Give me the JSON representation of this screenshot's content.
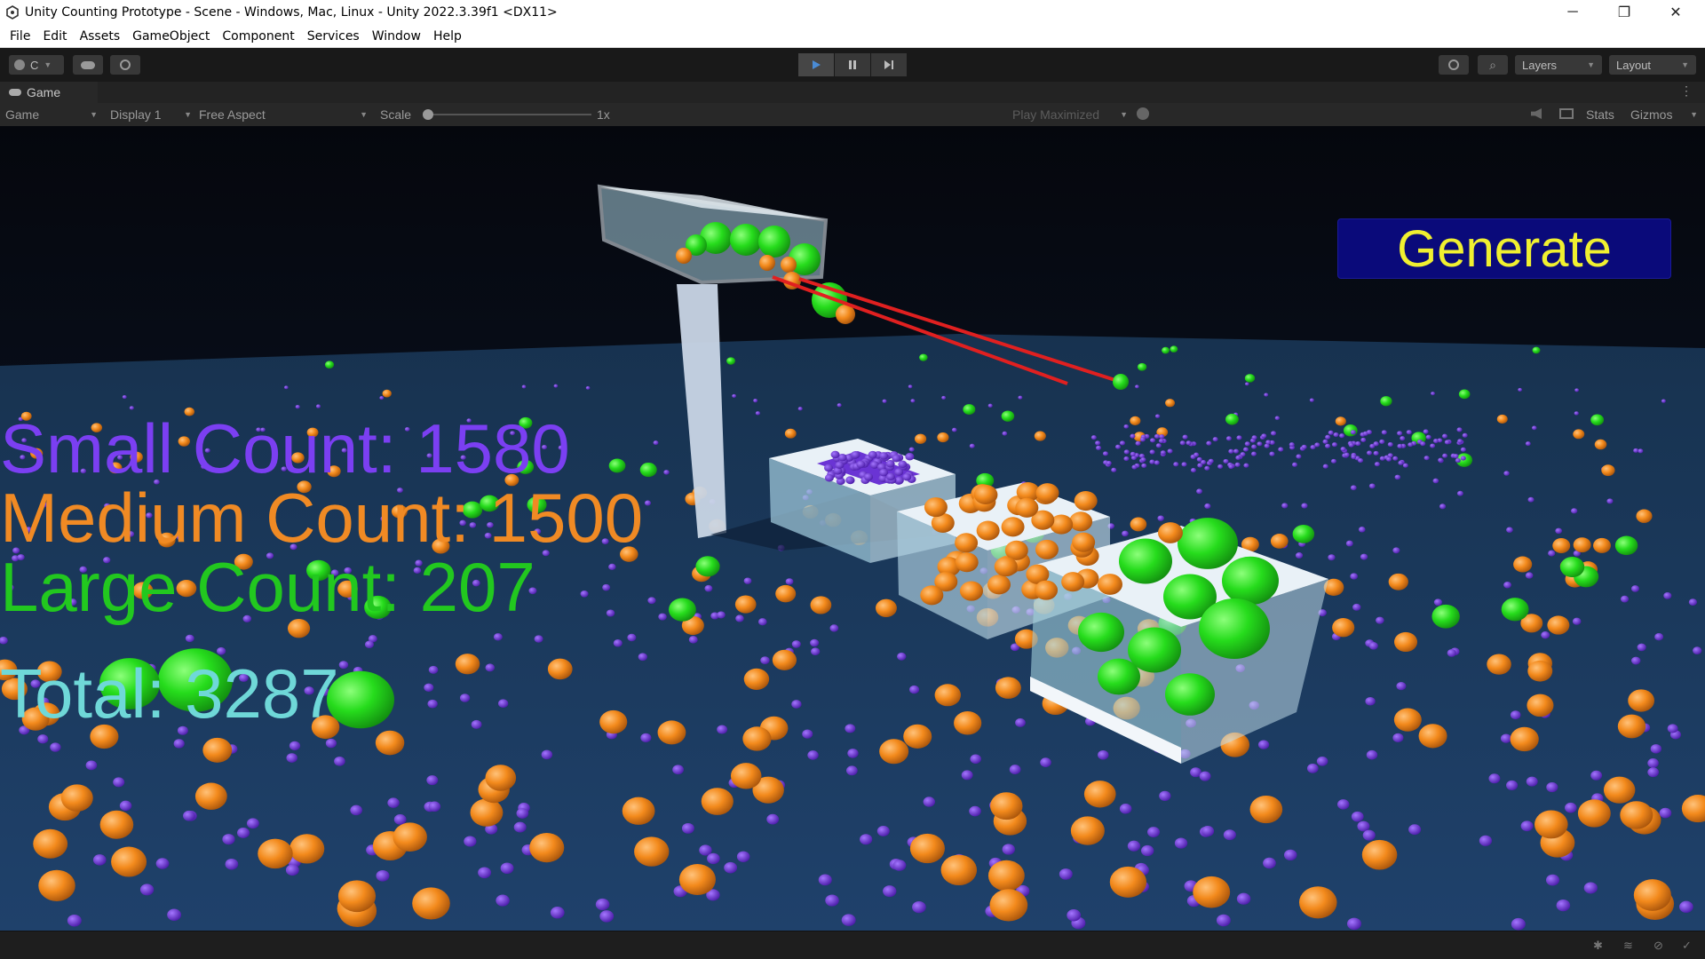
{
  "window": {
    "title": "Unity Counting Prototype - Scene - Windows, Mac, Linux - Unity 2022.3.39f1 <DX11>",
    "minimize": "─",
    "restore": "❐",
    "close": "✕"
  },
  "menu": [
    "File",
    "Edit",
    "Assets",
    "GameObject",
    "Component",
    "Services",
    "Window",
    "Help"
  ],
  "toolbar": {
    "account_label": "C",
    "layers_label": "Layers",
    "layout_label": "Layout"
  },
  "game_tab": {
    "label": "Game"
  },
  "game_bar": {
    "view_select": "Game",
    "display_select": "Display 1",
    "aspect_select": "Free Aspect",
    "scale_label": "Scale",
    "scale_value": "1x",
    "play_mode_select": "Play Maximized",
    "stats_label": "Stats",
    "gizmos_label": "Gizmos"
  },
  "hud": {
    "small_count": "Small Count: 1580",
    "medium_count": "Medium Count: 1500",
    "large_count": "Large Count: 207",
    "total": "Total: 3287",
    "generate_button": "Generate"
  },
  "colors": {
    "small": "#7b3ff2",
    "medium": "#f08a24",
    "large": "#22d822",
    "total": "#6fd8d8",
    "generate_text": "#f0f030",
    "generate_bg": "#0a0a7a",
    "sky": "#0b1530",
    "floor": "#1d3a62"
  }
}
